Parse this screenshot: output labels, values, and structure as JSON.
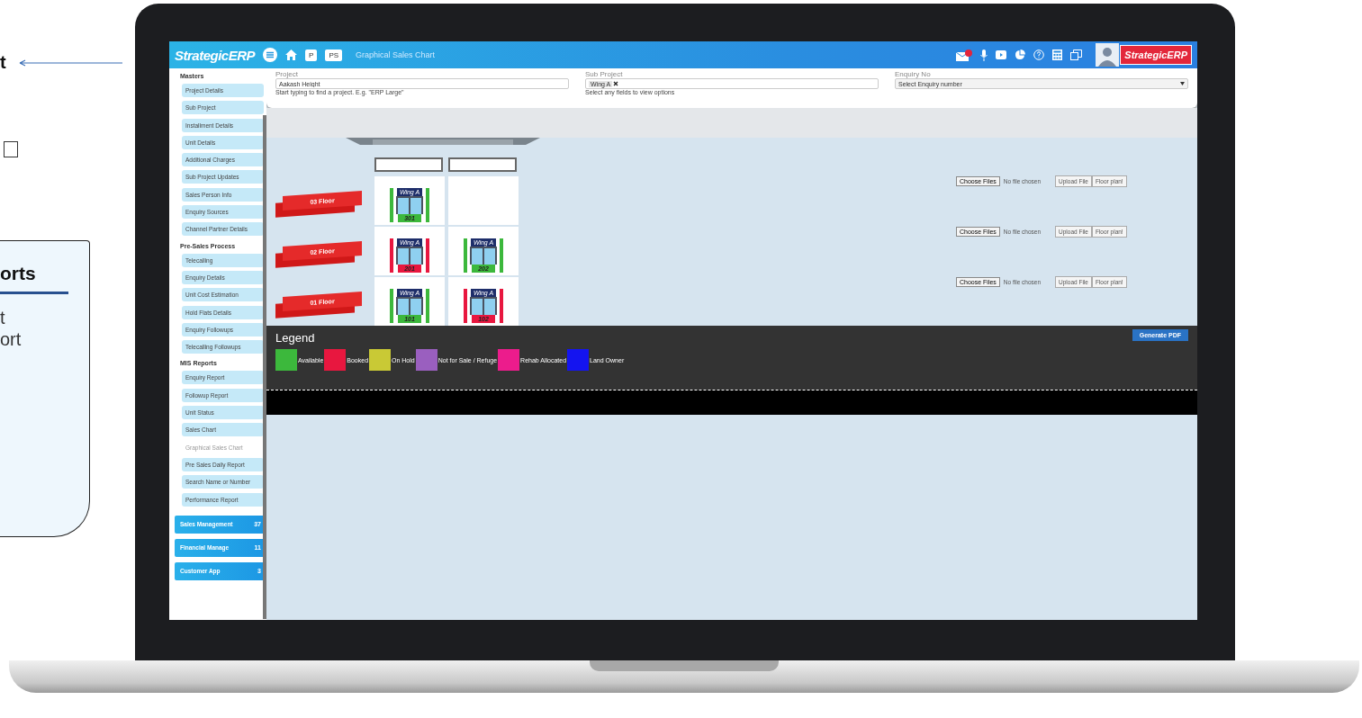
{
  "side_fragments": {
    "top_label": "t",
    "card_title": "orts",
    "card_lines": [
      "t",
      "ort"
    ]
  },
  "header": {
    "logo": "StrategicERP",
    "nav_buttons": [
      "P",
      "PS"
    ],
    "title": "Graphical Sales Chart",
    "brand": "StrategicERP"
  },
  "sidebar": {
    "sections": [
      {
        "title": "Masters",
        "items": [
          {
            "label": "Project Details",
            "selected": false
          },
          {
            "label": "Sub Project",
            "selected": false
          },
          {
            "label": "Installment Details",
            "selected": false
          },
          {
            "label": "Unit Details",
            "selected": false
          },
          {
            "label": "Additional Charges",
            "selected": false
          },
          {
            "label": "Sub Project Updates",
            "selected": false
          },
          {
            "label": "Sales Person Info",
            "selected": false
          },
          {
            "label": "Enquiry Sources",
            "selected": false
          },
          {
            "label": "Channel Partner Details",
            "selected": false
          }
        ]
      },
      {
        "title": "Pre-Sales Process",
        "items": [
          {
            "label": "Telecalling",
            "selected": false
          },
          {
            "label": "Enquiry Details",
            "selected": false
          },
          {
            "label": "Unit Cost Estimation",
            "selected": false
          },
          {
            "label": "Hold Flats Details",
            "selected": false
          },
          {
            "label": "Enquiry Followups",
            "selected": false
          },
          {
            "label": "Telecalling Followups",
            "selected": false
          }
        ]
      },
      {
        "title": "MIS Reports",
        "items": [
          {
            "label": "Enquiry Report",
            "selected": false
          },
          {
            "label": "Followup Report",
            "selected": false
          },
          {
            "label": "Unit Status",
            "selected": false
          },
          {
            "label": "Sales Chart",
            "selected": false
          },
          {
            "label": "Graphical Sales Chart",
            "selected": true
          },
          {
            "label": "Pre Sales Daily Report",
            "selected": false
          },
          {
            "label": "Search Name or Number",
            "selected": false
          },
          {
            "label": "Performance Report",
            "selected": false
          }
        ]
      }
    ],
    "modules": [
      {
        "label": "Sales Management",
        "count": "37"
      },
      {
        "label": "Financial Manage",
        "count": "11"
      },
      {
        "label": "Customer App",
        "count": "3"
      }
    ]
  },
  "filters": {
    "project": {
      "label": "Project",
      "value": "Aakash Height",
      "hint": "Start typing to find a project. E.g. \"ERP Large\""
    },
    "sub_project": {
      "label": "Sub Project",
      "tag": "Wing A",
      "hint": "Select any fields to view options"
    },
    "enquiry": {
      "label": "Enquiry No",
      "placeholder": "Select Enquiry number"
    }
  },
  "building": {
    "floors": [
      {
        "label": "03 Floor",
        "units": [
          {
            "wing": "Wing A",
            "number": "301",
            "color": "#3cb83c"
          }
        ],
        "choose_button": "Choose Files",
        "file_status": "No file chosen",
        "upload_button": "Upload File",
        "plan_button": "Floor plan!"
      },
      {
        "label": "02 Floor",
        "units": [
          {
            "wing": "Wing A",
            "number": "201",
            "color": "#e8173f"
          },
          {
            "wing": "Wing A",
            "number": "202",
            "color": "#3cb83c"
          }
        ],
        "choose_button": "Choose Files",
        "file_status": "No file chosen",
        "upload_button": "Upload File",
        "plan_button": "Floor plan!"
      },
      {
        "label": "01 Floor",
        "units": [
          {
            "wing": "Wing A",
            "number": "101",
            "color": "#3cb83c"
          },
          {
            "wing": "Wing A",
            "number": "102",
            "color": "#e8173f"
          }
        ],
        "choose_button": "Choose Files",
        "file_status": "No file chosen",
        "upload_button": "Upload File",
        "plan_button": "Floor plan!"
      }
    ]
  },
  "legend": {
    "title": "Legend",
    "pdf_button": "Generate PDF",
    "items": [
      {
        "label": "Available",
        "color": "#3cb83c"
      },
      {
        "label": "Booked",
        "color": "#e8173f"
      },
      {
        "label": "On Hold",
        "color": "#c9c935"
      },
      {
        "label": "Not for Sale / Refuge",
        "color": "#9a5fbf"
      },
      {
        "label": "Rehab Allocated",
        "color": "#ec1c8c"
      },
      {
        "label": "Land Owner",
        "color": "#1414f0"
      }
    ]
  }
}
